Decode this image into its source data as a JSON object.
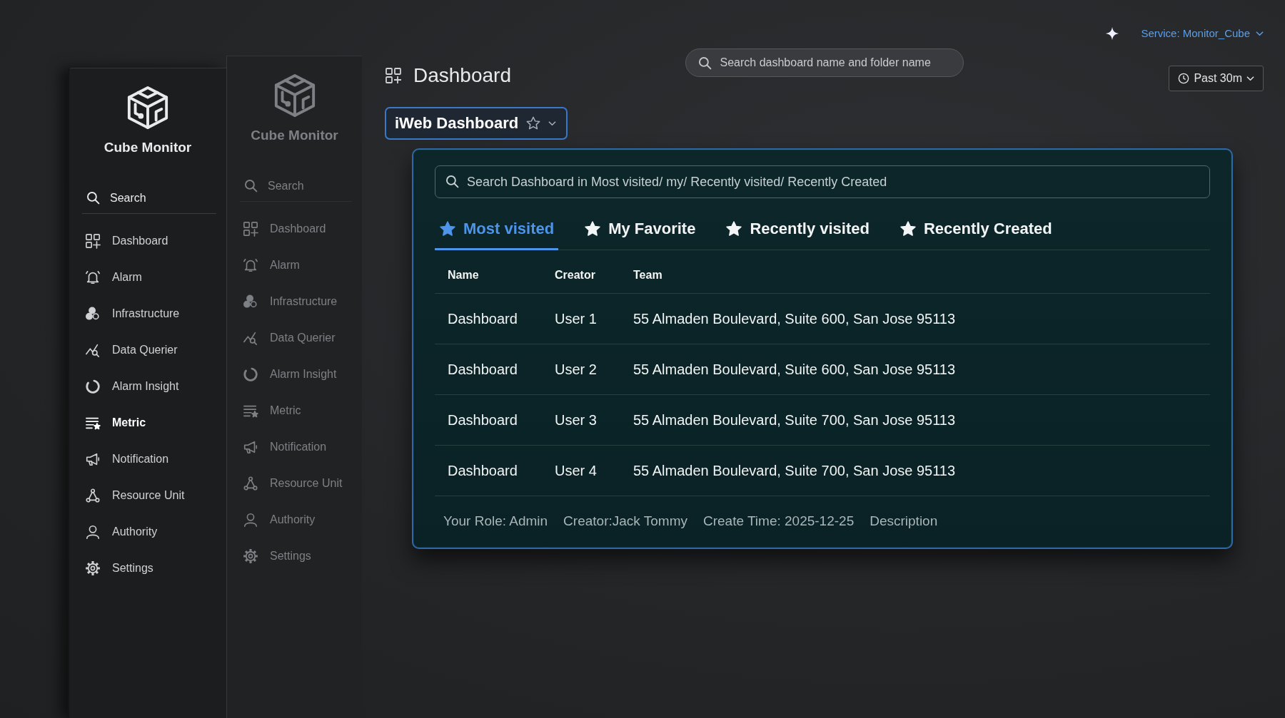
{
  "sidebars": [
    {
      "brand": "Cube Monitor",
      "dimmed": false,
      "search": {
        "placeholder": "Search"
      },
      "items": [
        {
          "label": "Dashboard",
          "selected": false
        },
        {
          "label": "Alarm",
          "selected": false
        },
        {
          "label": "Infrastructure",
          "selected": false
        },
        {
          "label": "Data Querier",
          "selected": false
        },
        {
          "label": "Alarm Insight",
          "selected": false
        },
        {
          "label": "Metric",
          "selected": true
        },
        {
          "label": "Notification",
          "selected": false
        },
        {
          "label": "Resource Unit",
          "selected": false
        },
        {
          "label": "Authority",
          "selected": false
        },
        {
          "label": "Settings",
          "selected": false
        }
      ]
    },
    {
      "brand": "Cube Monitor",
      "dimmed": true,
      "search": {
        "placeholder": "Search"
      },
      "items": [
        {
          "label": "Dashboard",
          "selected": false
        },
        {
          "label": "Alarm",
          "selected": false
        },
        {
          "label": "Infrastructure",
          "selected": false
        },
        {
          "label": "Data Querier",
          "selected": false
        },
        {
          "label": "Alarm Insight",
          "selected": false
        },
        {
          "label": "Metric",
          "selected": false
        },
        {
          "label": "Notification",
          "selected": false
        },
        {
          "label": "Resource Unit",
          "selected": false
        },
        {
          "label": "Authority",
          "selected": false
        },
        {
          "label": "Settings",
          "selected": false
        }
      ]
    }
  ],
  "header": {
    "title": "Dashboard",
    "search": {
      "placeholder": "Search dashboard name and folder name"
    },
    "service": "Service: Monitor_Cube",
    "time_range": "Past 30m"
  },
  "dashboard_picker": {
    "label": "iWeb Dashboard",
    "favorite": false
  },
  "popup": {
    "search": {
      "placeholder": "Search Dashboard in Most visited/ my/ Recently visited/ Recently Created"
    },
    "tabs": [
      {
        "label": "Most visited",
        "selected": true
      },
      {
        "label": "My Favorite",
        "selected": false
      },
      {
        "label": "Recently visited",
        "selected": false
      },
      {
        "label": "Recently Created",
        "selected": false
      }
    ],
    "table": {
      "columns": [
        "Name",
        "Creator",
        "Team"
      ],
      "rows": [
        [
          "Dashboard",
          "User 1",
          "55 Almaden Boulevard, Suite 600, San Jose 95113"
        ],
        [
          "Dashboard",
          "User 2",
          "55 Almaden Boulevard, Suite 600, San Jose 95113"
        ],
        [
          "Dashboard",
          "User 3",
          "55 Almaden Boulevard, Suite 700, San Jose 95113"
        ],
        [
          "Dashboard",
          "User 4",
          "55 Almaden Boulevard, Suite 700, San Jose 95113"
        ]
      ]
    },
    "footer": [
      "Your Role: Admin",
      "Creator:Jack Tommy",
      "Create Time: 2025-12-25",
      "Description"
    ]
  }
}
